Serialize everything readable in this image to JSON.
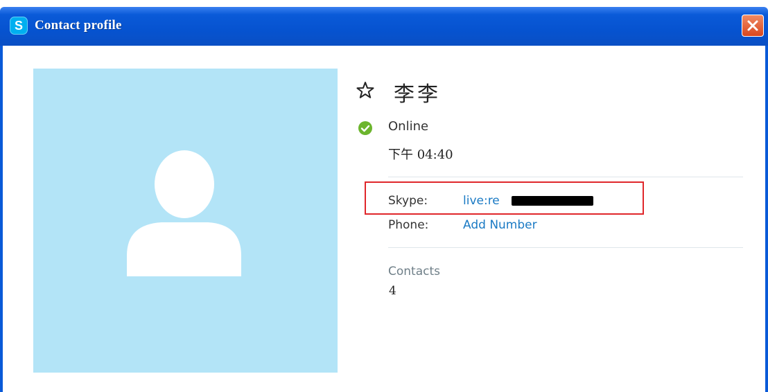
{
  "window": {
    "app_icon_letter": "S",
    "title": "Contact profile",
    "close_icon": "close-icon"
  },
  "profile": {
    "avatar_icon": "default-avatar-icon",
    "favorite_icon": "star-outline-icon",
    "name": "李李",
    "status_icon": "online-check-icon",
    "status": "Online",
    "local_time": "下午 04:40"
  },
  "details": {
    "skype_label": "Skype:",
    "skype_value": "live:re",
    "phone_label": "Phone:",
    "phone_value": "Add Number",
    "contacts_label": "Contacts",
    "contacts_count": "4"
  },
  "colors": {
    "titlebar": "#0653d0",
    "avatar_bg": "#b3e4f7",
    "link": "#1a7ac4",
    "online": "#6cb52d",
    "highlight": "#e0262a"
  }
}
